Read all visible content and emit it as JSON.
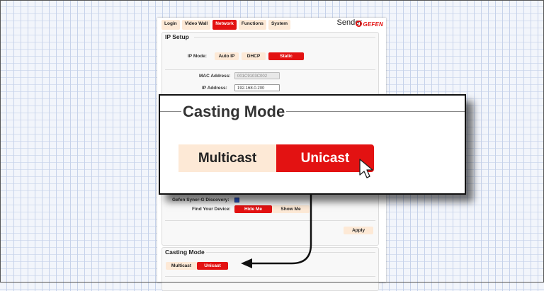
{
  "tabs": [
    "Login",
    "Video Wall",
    "Network",
    "Functions",
    "System"
  ],
  "active_tab": "Network",
  "header": {
    "device_label": "Sender",
    "brand": "GEFEN"
  },
  "ip_setup": {
    "title": "IP Setup",
    "ip_mode_label": "IP Mode:",
    "modes": [
      "Auto IP",
      "DHCP",
      "Static"
    ],
    "selected_mode": "Static",
    "mac_label": "MAC Address:",
    "mac_value": "001C9103C002",
    "ip_label": "IP Address:",
    "ip_value": "192.168.0.200"
  },
  "discovery": {
    "syner_label": "Gefen Syner-G Discovery:",
    "find_label": "Find Your Device:",
    "hide_label": "Hide Me",
    "show_label": "Show Me",
    "apply_label": "Apply"
  },
  "casting_mode": {
    "title": "Casting Mode",
    "multicast_label": "Multicast",
    "unicast_label": "Unicast",
    "selected": "Unicast"
  },
  "callout": {
    "title": "Casting Mode",
    "multicast_label": "Multicast",
    "unicast_label": "Unicast"
  },
  "colors": {
    "accent_red": "#e31212",
    "inactive_button": "#fde9d6"
  }
}
